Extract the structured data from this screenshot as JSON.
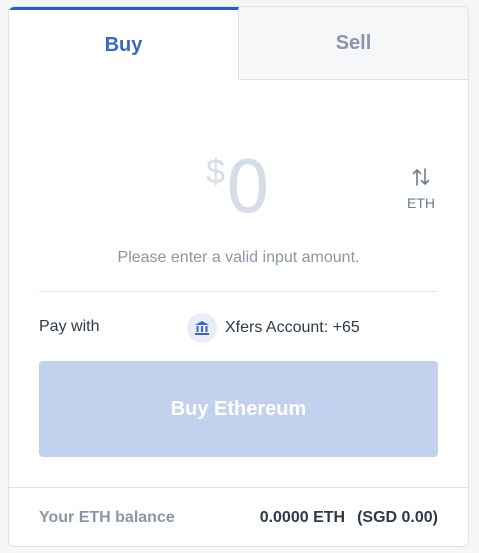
{
  "tabs": [
    {
      "label": "Buy",
      "active": true
    },
    {
      "label": "Sell",
      "active": false
    }
  ],
  "amount": {
    "currency_symbol": "$",
    "value": "0",
    "toggle_icon": "swap-vertical-arrows-icon",
    "toggle_label": "ETH"
  },
  "hint": "Please enter a valid input amount.",
  "payment": {
    "label": "Pay with",
    "icon": "bank-icon",
    "account": "Xfers Account: +65"
  },
  "action": {
    "label": "Buy Ethereum"
  },
  "balance": {
    "label": "Your ETH balance",
    "eth": "0.0000 ETH",
    "fiat": "(SGD 0.00)"
  },
  "colors": {
    "accent": "#3a67c7",
    "button_disabled": "#c1d1ee",
    "muted_text": "#8a97a6",
    "amount_placeholder": "#d6dde5"
  }
}
